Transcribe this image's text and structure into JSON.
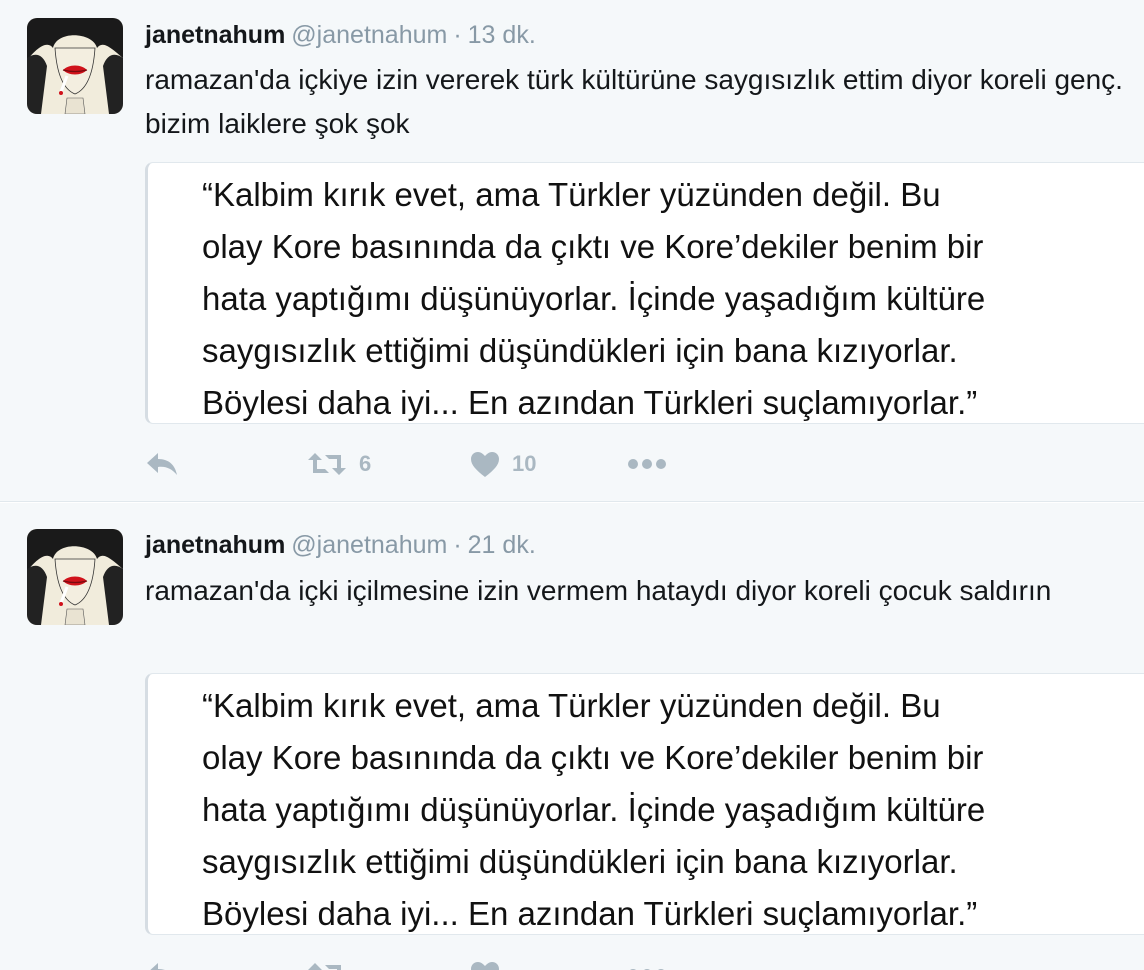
{
  "tweets": [
    {
      "fullname": "janetnahum",
      "handle": "@janetnahum",
      "separator": "·",
      "time": "13 dk.",
      "text": "ramazan'da içkiye izin vererek türk kültürüne saygısızlık ettim diyor koreli genç. bizim laiklere şok şok",
      "quote_lines": [
        "“Kalbim kırık evet, ama Türkler yüzünden değil. Bu",
        "olay Kore basınında da çıktı ve Kore’dekiler benim bir",
        "hata yaptığımı düşünüyorlar. İçinde yaşadığım kültüre",
        "saygısızlık ettiğimi düşündükleri için bana kızıyorlar.",
        "Böylesi daha iyi... En azından Türkleri suçlamıyorlar.”"
      ],
      "retweet_count": "6",
      "like_count": "10",
      "icons": {
        "reply": "reply-icon",
        "retweet": "retweet-icon",
        "like": "heart-icon",
        "more": "more-icon"
      }
    },
    {
      "fullname": "janetnahum",
      "handle": "@janetnahum",
      "separator": "·",
      "time": "21 dk.",
      "text": "ramazan'da içki içilmesine izin vermem hataydı diyor koreli çocuk saldırın",
      "quote_lines": [
        "“Kalbim kırık evet, ama Türkler yüzünden değil. Bu",
        "olay Kore basınında da çıktı ve Kore’dekiler benim bir",
        "hata yaptığımı düşünüyorlar. İçinde yaşadığım kültüre",
        "saygısızlık ettiğimi düşündükleri için bana kızıyorlar.",
        "Böylesi daha iyi... En azından Türkleri suçlamıyorlar.”"
      ],
      "retweet_count": "",
      "like_count": "",
      "icons": {
        "reply": "reply-icon",
        "retweet": "retweet-icon",
        "like": "heart-icon",
        "more": "more-icon"
      }
    }
  ],
  "colors": {
    "background": "#f5f8fa",
    "action_icon": "#aab8c2",
    "secondary_text": "#8899a6",
    "primary_text": "#14171a",
    "lipstick": "#d0121b"
  }
}
